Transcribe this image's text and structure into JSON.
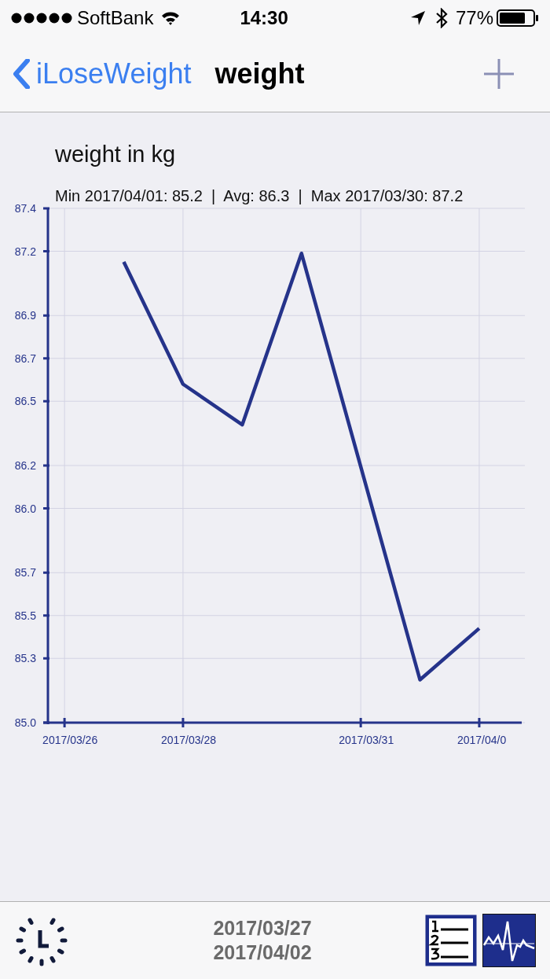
{
  "status_bar": {
    "carrier": "SoftBank",
    "time": "14:30",
    "battery": "77%"
  },
  "nav_bar": {
    "back": "iLoseWeight",
    "title": "weight"
  },
  "chart": {
    "title": "weight in kg",
    "summary": "Min 2017/04/01: 85.2  |  Avg: 86.3  |  Max 2017/03/30: 87.2",
    "chart_data": {
      "type": "line",
      "grid": true,
      "categories": [
        "2017/03/26",
        null,
        "2017/03/28",
        null,
        null,
        "2017/03/31",
        null,
        "2017/04/0"
      ],
      "series": [
        {
          "color": "#25338a",
          "values": [
            null,
            87.15,
            86.58,
            86.39,
            87.19,
            null,
            85.2,
            85.44
          ]
        }
      ],
      "ylim": [
        85.0,
        87.4
      ],
      "yticks": [
        {
          "value": 85.0,
          "label": "85.0"
        },
        {
          "value": 85.3,
          "label": "85.3"
        },
        {
          "value": 85.5,
          "label": "85.5"
        },
        {
          "value": 85.7,
          "label": "85.7"
        },
        {
          "value": 86.0,
          "label": "86.0"
        },
        {
          "value": 86.2,
          "label": "86.2"
        },
        {
          "value": 86.5,
          "label": "86.5"
        },
        {
          "value": 86.7,
          "label": "86.7"
        },
        {
          "value": 86.9,
          "label": "86.9"
        },
        {
          "value": 87.2,
          "label": "87.2"
        },
        {
          "value": 87.4,
          "label": "87.4"
        }
      ]
    }
  },
  "bottom_bar": {
    "range_start": "2017/03/27",
    "range_end": "2017/04/02"
  }
}
